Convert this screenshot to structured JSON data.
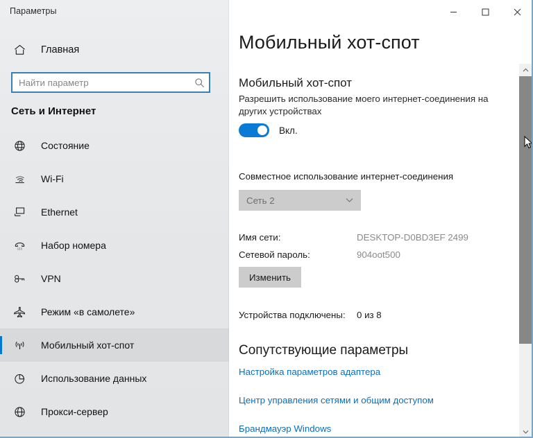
{
  "window": {
    "title": "Параметры",
    "controls": {
      "minimize": "minimize-icon",
      "maximize": "maximize-icon",
      "close": "close-icon"
    }
  },
  "sidebar": {
    "home": {
      "label": "Главная",
      "icon": "home-icon"
    },
    "search": {
      "value": "",
      "placeholder": "Найти параметр",
      "icon": "search-icon"
    },
    "category": "Сеть и Интернет",
    "items": [
      {
        "label": "Состояние",
        "icon": "globe-status-icon",
        "selected": false
      },
      {
        "label": "Wi-Fi",
        "icon": "wifi-icon",
        "selected": false
      },
      {
        "label": "Ethernet",
        "icon": "monitor-icon",
        "selected": false
      },
      {
        "label": "Набор номера",
        "icon": "dialup-phone-icon",
        "selected": false
      },
      {
        "label": "VPN",
        "icon": "vpn-key-icon",
        "selected": false
      },
      {
        "label": "Режим «в самолете»",
        "icon": "airplane-icon",
        "selected": false
      },
      {
        "label": "Мобильный хот-спот",
        "icon": "hotspot-icon",
        "selected": true
      },
      {
        "label": "Использование данных",
        "icon": "pie-chart-icon",
        "selected": false
      },
      {
        "label": "Прокси-сервер",
        "icon": "globe-proxy-icon",
        "selected": false
      }
    ]
  },
  "main": {
    "page_title": "Мобильный хот-спот",
    "hotspot": {
      "heading": "Мобильный хот-спот",
      "description": "Разрешить использование моего интернет-соединения на других устройствах",
      "toggle_state": "Вкл."
    },
    "sharing": {
      "label": "Совместное использование интернет-соединения",
      "selected_option": "Сеть 2"
    },
    "network": {
      "name_label": "Имя сети:",
      "name_value": "DESKTOP-D0BD3EF 2499",
      "password_label": "Сетевой пароль:",
      "password_value": "904oot500",
      "edit_button": "Изменить"
    },
    "devices": {
      "label": "Устройства подключены:",
      "value": "0 из 8"
    },
    "related": {
      "title": "Сопутствующие параметры",
      "links": [
        "Настройка параметров адаптера",
        "Центр управления сетями и общим доступом",
        "Брандмауэр Windows"
      ]
    }
  },
  "colors": {
    "accent": "#0078d7",
    "link": "#0a6ebd",
    "toggle_on": "#0a7ad4",
    "sidebar_bg": "#e6e8ea",
    "control_bg": "#cccccc"
  }
}
